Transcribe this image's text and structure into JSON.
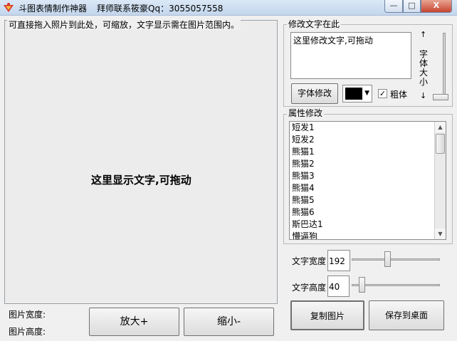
{
  "window": {
    "title": "斗图表情制作神器",
    "subtitle": "拜师联系筱豪Qq：3055057558",
    "min_label": "—",
    "max_label": "□",
    "close_label": "X"
  },
  "canvas": {
    "caption": "可直接拖入照片到此处，可缩放，文字显示需在图片范围内。",
    "overlay_text": "这里显示文字,可拖动"
  },
  "image_info": {
    "width_label": "图片宽度:",
    "height_label": "图片高度:"
  },
  "zoom": {
    "zoom_in_label": "放大+",
    "zoom_out_label": "缩小-"
  },
  "edit_text": {
    "group_title": "修改文字在此",
    "text_value": "这里修改文字,可拖动",
    "font_button_label": "字体修改",
    "font_color": "#000000",
    "bold_label": "粗体",
    "bold_checked": "✓"
  },
  "font_size_slider": {
    "up_arrow": "↑",
    "down_arrow": "↓",
    "label": "字体大小"
  },
  "properties": {
    "group_title": "属性修改",
    "items": [
      "短发1",
      "短发2",
      "熊猫1",
      "熊猫2",
      "熊猫3",
      "熊猫4",
      "熊猫5",
      "熊猫6",
      "斯巴达1",
      "懵逼狗"
    ]
  },
  "text_size": {
    "width_label": "文字宽度",
    "width_value": "192",
    "height_label": "文字高度",
    "height_value": "40"
  },
  "actions": {
    "copy_label": "复制图片",
    "save_label": "保存到桌面"
  },
  "colors": {
    "title_gradient_top": "#dbe8f6",
    "close_button": "#c7452f",
    "background": "#f0f0f0"
  }
}
